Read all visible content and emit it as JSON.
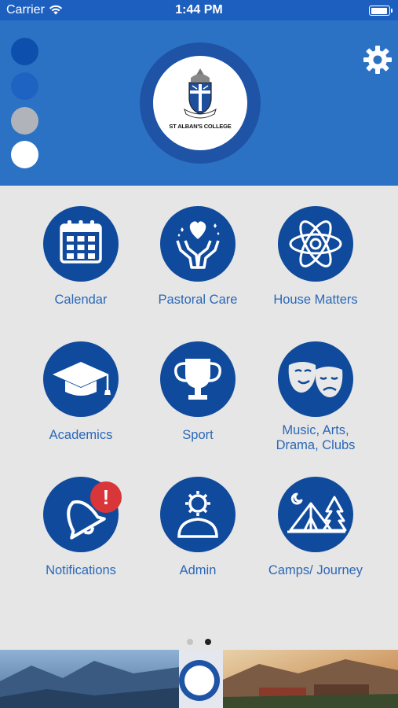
{
  "status_bar": {
    "carrier": "Carrier",
    "time": "1:44 PM"
  },
  "header": {
    "logo_text": "ST ALBAN'S COLLEGE",
    "swatches": [
      "#0d4fad",
      "#1e63c2",
      "#b0b4ba",
      "#ffffff"
    ],
    "settings_icon": "gear-icon"
  },
  "menu": [
    {
      "label": "Calendar",
      "icon": "calendar-icon"
    },
    {
      "label": "Pastoral Care",
      "icon": "heart-hands-icon"
    },
    {
      "label": "House Matters",
      "icon": "atom-icon"
    },
    {
      "label": "Academics",
      "icon": "graduation-cap-icon"
    },
    {
      "label": "Sport",
      "icon": "trophy-icon"
    },
    {
      "label": "Music, Arts,\nDrama, Clubs",
      "icon": "theatre-masks-icon"
    },
    {
      "label": "Notifications",
      "icon": "bell-icon",
      "badge": "!"
    },
    {
      "label": "Admin",
      "icon": "user-gear-icon"
    },
    {
      "label": "Camps/ Journey",
      "icon": "tent-icon"
    }
  ],
  "pager": {
    "pages": 2,
    "current": 2
  },
  "colors": {
    "brand_blue": "#0f4a9c",
    "header_blue": "#2c72c4",
    "label_blue": "#2b68b8",
    "badge_red": "#d9363a"
  }
}
